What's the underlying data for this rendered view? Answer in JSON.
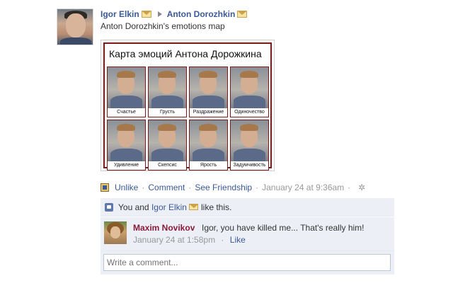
{
  "post": {
    "author": "Igor Elkin",
    "recipient": "Anton Dorozhkin",
    "text": "Anton Dorozhkin's emotions map"
  },
  "photo": {
    "title": "Карта эмоций Антона Дорожкина",
    "captions": [
      "Счастье",
      "Грусть",
      "Раздражение",
      "Одиночество",
      "Удивление",
      "Скепсис",
      "Ярость",
      "Задумчивость"
    ]
  },
  "actions": {
    "unlike": "Unlike",
    "comment": "Comment",
    "see_friendship": "See Friendship",
    "timestamp": "January 24 at 9:36am",
    "separator": "·"
  },
  "likes": {
    "prefix": "You and",
    "person": "Igor Elkin",
    "suffix": "like this."
  },
  "comment": {
    "author": "Maxim Novikov",
    "text": "Igor, you have killed me... That's really him!",
    "timestamp": "January 24 at 1:58pm",
    "like": "Like"
  },
  "write_comment": {
    "placeholder": "Write a comment..."
  },
  "colors": {
    "link": "#3b5998",
    "comment_author": "#8b1a3a",
    "ufi_background": "#eceff5",
    "photo_border": "#7a1b1b"
  },
  "icons": {
    "mail": "mail-icon",
    "arrow": "arrow-right-icon",
    "like": "thumbs-up-icon",
    "settings": "gear-icon",
    "stream": "stream-icon"
  }
}
